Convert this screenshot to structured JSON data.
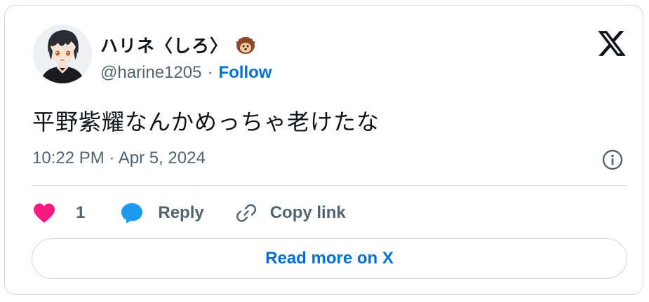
{
  "author": {
    "display_name": "ハリネ〈しろ〉",
    "handle": "@harine1205",
    "separator": "·",
    "follow_label": "Follow",
    "emoji_icon": "hedgehog-icon"
  },
  "tweet": {
    "text": "平野紫耀なんかめっちゃ老けたな",
    "timestamp": "10:22 PM · Apr 5, 2024"
  },
  "actions": {
    "like_count": "1",
    "reply_label": "Reply",
    "copy_link_label": "Copy link"
  },
  "read_more_label": "Read more on X",
  "colors": {
    "like": "#f91880",
    "reply": "#1d9bf0",
    "link": "#006fd6",
    "muted": "#536471",
    "text": "#0f1419",
    "border": "#cfd9de"
  }
}
